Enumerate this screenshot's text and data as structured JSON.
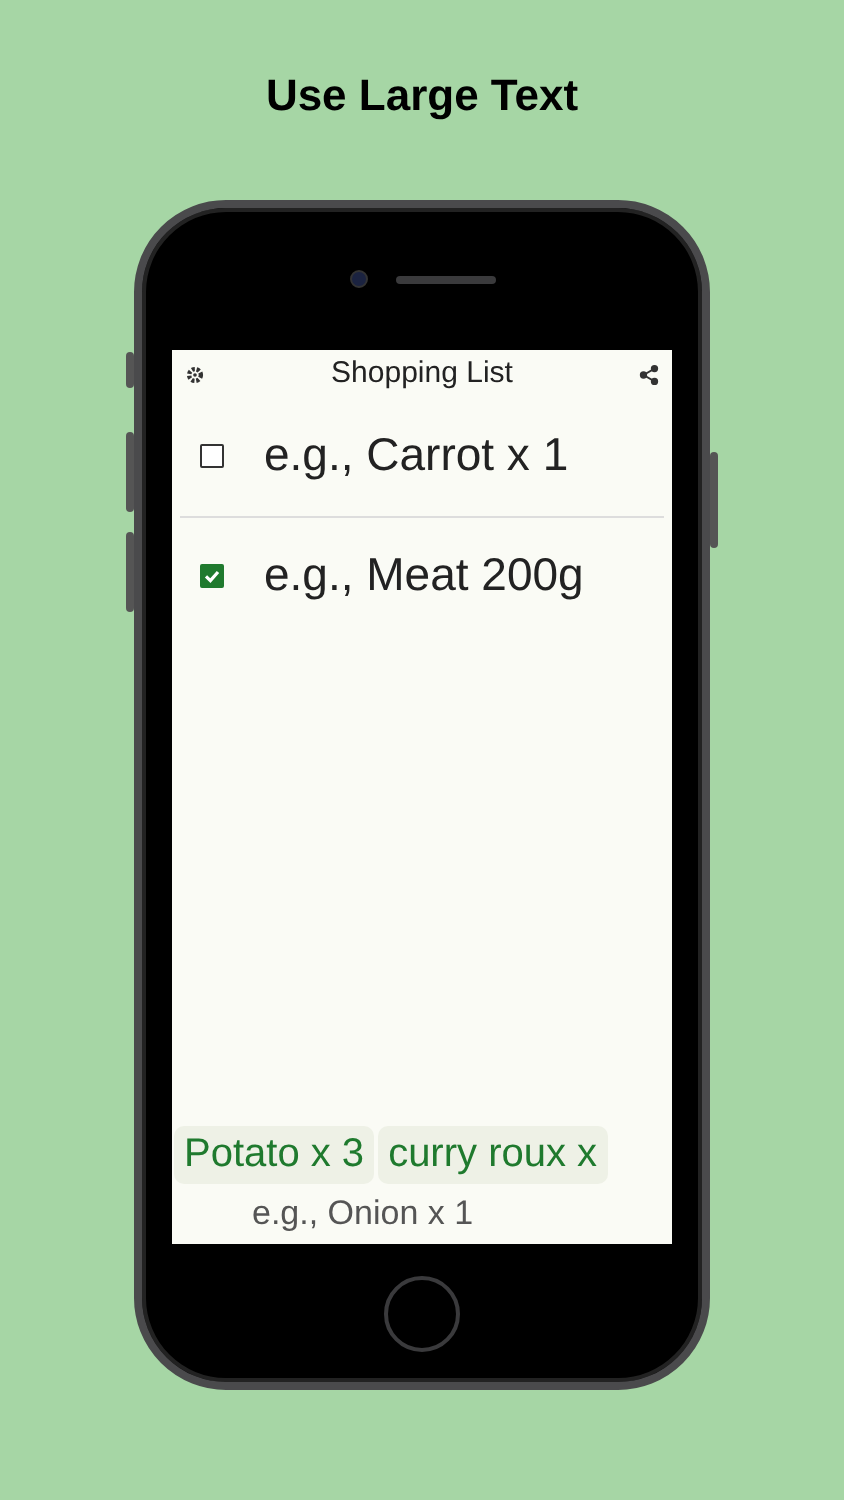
{
  "heading": "Use Large Text",
  "app": {
    "title": "Shopping List",
    "items": [
      {
        "text": "e.g., Carrot x 1",
        "checked": false
      },
      {
        "text": "e.g., Meat 200g",
        "checked": true
      }
    ],
    "suggestions": [
      "Potato x 3",
      "curry roux x"
    ],
    "input": {
      "placeholder": "e.g., Onion x 1"
    }
  }
}
